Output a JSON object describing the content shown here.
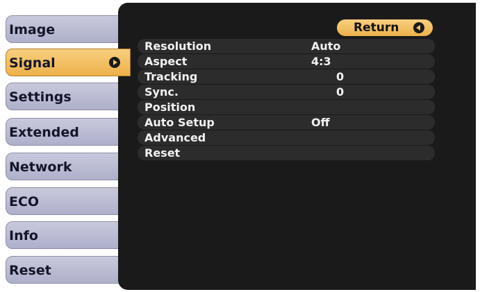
{
  "tabs": [
    {
      "label": "Image"
    },
    {
      "label": "Signal"
    },
    {
      "label": "Settings"
    },
    {
      "label": "Extended"
    },
    {
      "label": "Network"
    },
    {
      "label": "ECO"
    },
    {
      "label": "Info"
    },
    {
      "label": "Reset"
    }
  ],
  "active_tab": "Signal",
  "return_button": {
    "label": "Return"
  },
  "settings": [
    {
      "label": "Resolution",
      "value": "Auto"
    },
    {
      "label": "Aspect",
      "value": "4:3"
    },
    {
      "label": "Tracking",
      "value": "0"
    },
    {
      "label": "Sync.",
      "value": "0"
    },
    {
      "label": "Position",
      "value": ""
    },
    {
      "label": "Auto Setup",
      "value": "Off"
    },
    {
      "label": "Advanced",
      "value": ""
    },
    {
      "label": "Reset",
      "value": ""
    }
  ],
  "colors": {
    "panel_bg": "#1a1a1a",
    "tab_bg": "#b9bbd3",
    "active_accent": "#f3c66a"
  }
}
